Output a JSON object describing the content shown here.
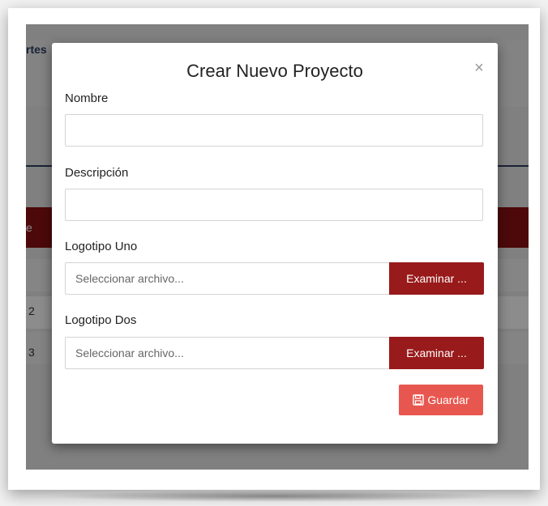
{
  "background": {
    "header_text": "rtes",
    "band_text": "e",
    "rows": [
      "2",
      "3"
    ]
  },
  "modal": {
    "title": "Crear Nuevo Proyecto",
    "close_glyph": "×",
    "fields": {
      "nombre": {
        "label": "Nombre",
        "value": "",
        "placeholder": ""
      },
      "descripcion": {
        "label": "Descripción",
        "value": "",
        "placeholder": ""
      },
      "logo_uno": {
        "label": "Logotipo Uno",
        "file_text": "Seleccionar archivo...",
        "button": "Examinar ..."
      },
      "logo_dos": {
        "label": "Logotipo Dos",
        "file_text": "Seleccionar archivo...",
        "button": "Examinar ..."
      }
    },
    "save_button": {
      "label": "Guardar",
      "icon": "floppy-disk-icon"
    }
  },
  "colors": {
    "overlay": "#000000",
    "examinar_button": "#981a1a",
    "save_button": "#e8574f",
    "background_band": "#8c1212",
    "nav_line": "#2e3f63"
  }
}
